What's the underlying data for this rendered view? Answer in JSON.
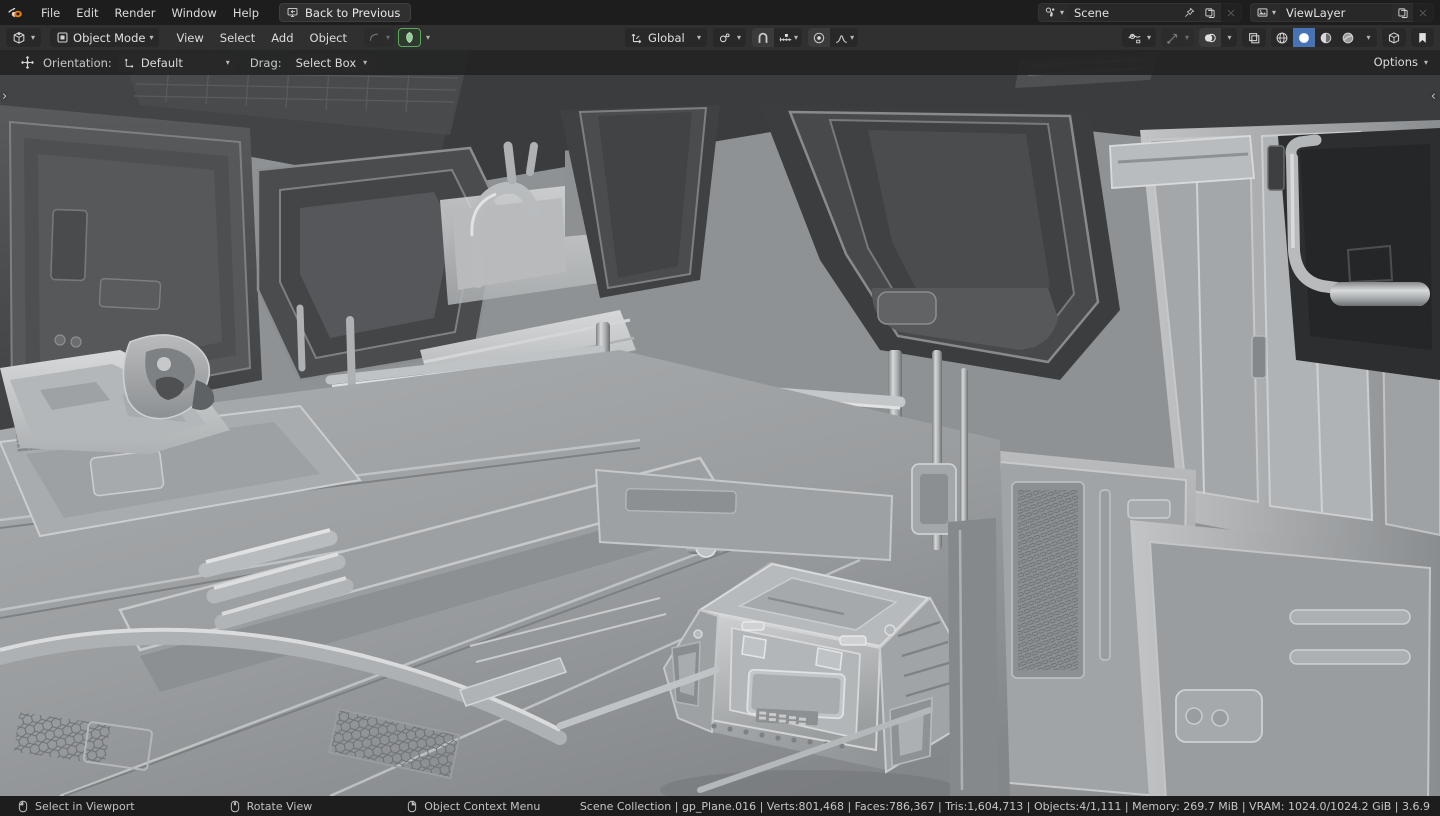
{
  "app": {
    "name": "Blender",
    "version_label": "3.6.9"
  },
  "topbar": {
    "logo_icon": "blender-logo-icon",
    "menus": [
      {
        "label": "File",
        "name": "menu-file"
      },
      {
        "label": "Edit",
        "name": "menu-edit"
      },
      {
        "label": "Render",
        "name": "menu-render"
      },
      {
        "label": "Window",
        "name": "menu-window"
      },
      {
        "label": "Help",
        "name": "menu-help"
      }
    ],
    "back_to_previous": {
      "label": "Back to Previous",
      "icon": "back-to-previous-icon"
    },
    "scene": {
      "icon": "scene-data-icon",
      "name": "Scene",
      "pin_icon": "pin-icon",
      "new_icon": "duplicate-icon",
      "unlink_icon": "close-x-icon"
    },
    "view_layer": {
      "icon": "view-layer-icon",
      "name": "ViewLayer",
      "new_icon": "duplicate-icon",
      "unlink_icon": "close-x-icon"
    }
  },
  "viewport_header": {
    "editor_type_icon": "editor-type-3d-viewport-icon",
    "mode": {
      "label": "Object Mode",
      "icon": "object-mode-icon"
    },
    "menus": [
      {
        "label": "View",
        "name": "viewport-menu-view"
      },
      {
        "label": "Select",
        "name": "viewport-menu-select"
      },
      {
        "label": "Add",
        "name": "viewport-menu-add"
      },
      {
        "label": "Object",
        "name": "viewport-menu-object"
      }
    ],
    "mode_selector_icons": [
      "curve-edit-icon",
      "gpencil-object-icon"
    ],
    "transform_orientation": {
      "label": "Global",
      "icon": "orientation-global-icon"
    },
    "pivot_point": {
      "icon": "pivot-point-icon"
    },
    "snap": {
      "magnet_icon": "snap-magnet-icon",
      "snap_to_icon": "snap-increment-icon"
    },
    "proportional_editing": {
      "icon": "proportional-edit-icon",
      "falloff_icon": "falloff-smooth-icon"
    },
    "visibility": {
      "icon": "object-types-visibility-icon"
    },
    "gizmo": {
      "icon": "gizmo-icon"
    },
    "overlays": {
      "icon": "overlays-icon"
    },
    "xray": {
      "icon": "toggle-xray-icon"
    },
    "shading": {
      "modes": [
        {
          "name": "shading-wireframe",
          "icon": "wireframe-icon",
          "active": false
        },
        {
          "name": "shading-solid",
          "icon": "solid-icon",
          "active": true
        },
        {
          "name": "shading-material",
          "icon": "material-preview-icon",
          "active": false
        },
        {
          "name": "shading-rendered",
          "icon": "rendered-icon",
          "active": false
        }
      ],
      "dropdown_icon": "chevron-down-icon"
    },
    "viewport_gizmo_right": [
      "viewport-gizmo-box-icon",
      "bookmark-icon"
    ]
  },
  "tool_settings": {
    "active_tool_icon": "tweak-tool-icon",
    "orientation_label": "Orientation:",
    "orientation_value": "Default",
    "orientation_icon": "orientation-default-icon",
    "drag_label": "Drag:",
    "drag_value": "Select Box",
    "options_label": "Options"
  },
  "viewport": {
    "left_panel_toggle": "›",
    "right_panel_toggle": "‹",
    "scene_description": "Greyscale solid-shaded sci-fi spaceship interior corridor with panels, pipes, railings and a hard-surface cargo crate in the foreground",
    "background_color": "#3c3c3c"
  },
  "statusbar": {
    "hints": [
      {
        "label": "Select in Viewport",
        "icon": "mouse-left-button-icon",
        "name": "status-hint-select"
      },
      {
        "label": "Rotate View",
        "icon": "mouse-middle-button-icon",
        "name": "status-hint-rotate"
      },
      {
        "label": "Object Context Menu",
        "icon": "mouse-right-button-icon",
        "name": "status-hint-context-menu"
      }
    ],
    "stats": "Scene Collection | gp_Plane.016 | Verts:801,468 | Faces:786,367 | Tris:1,604,713 | Objects:4/1,111 | Memory: 269.7 MiB | VRAM: 1024.0/1024.2 GiB | 3.6.9"
  },
  "colors": {
    "topbar_bg": "#1d1d1d",
    "header_bg": "#303030",
    "widget_bg": "#282828",
    "accent_blue": "#4772b3",
    "accent_green": "#5ca85c",
    "text": "#e0e0e0",
    "viewport_bg": "#3c3c3c"
  }
}
